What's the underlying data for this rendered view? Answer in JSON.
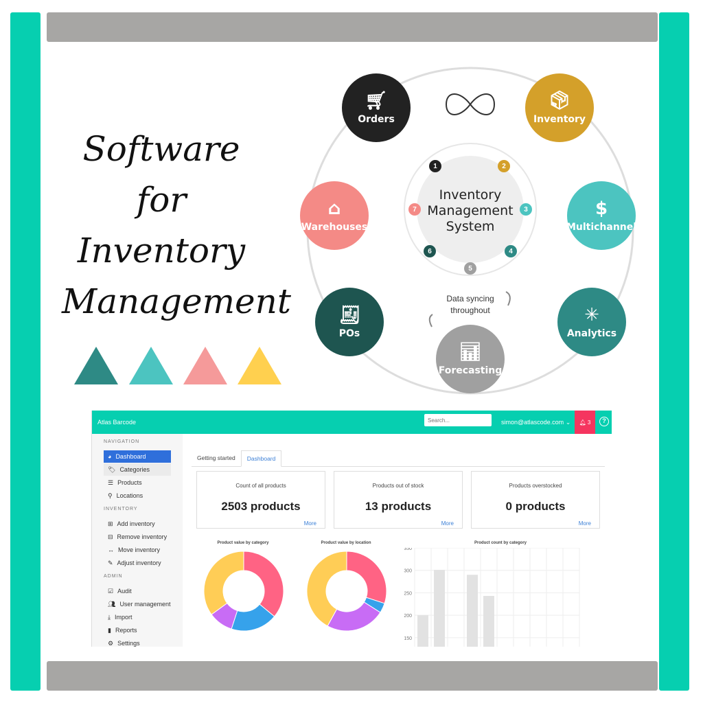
{
  "headline": {
    "line1": "Software",
    "line2": "for",
    "line3": "Inventory",
    "line4": "Management"
  },
  "triangle_colors": [
    "#2e8a85",
    "#4cc4c0",
    "#f59a9a",
    "#ffd04f"
  ],
  "diagram": {
    "center_label": [
      "Inventory",
      "Management",
      "System"
    ],
    "sync_label": [
      "Data syncing",
      "throughout"
    ],
    "nodes": [
      {
        "label": "Orders",
        "color": "#222222",
        "icon": "cart-icon"
      },
      {
        "label": "Inventory",
        "color": "#d4a02a",
        "icon": "box-icon"
      },
      {
        "label": "Warehouses",
        "color": "#f48a86",
        "icon": "warehouse-icon"
      },
      {
        "label": "Multichannel",
        "color": "#4cc4c0",
        "icon": "money-bag-icon"
      },
      {
        "label": "POs",
        "color": "#1e5550",
        "icon": "receipt-icon"
      },
      {
        "label": "Analytics",
        "color": "#2e8a85",
        "icon": "network-icon"
      },
      {
        "label": "Forecasting",
        "color": "#a0a0a0",
        "icon": "bar-chart-icon"
      }
    ],
    "numbers": [
      {
        "n": "1",
        "color": "#222222"
      },
      {
        "n": "2",
        "color": "#d4a02a"
      },
      {
        "n": "3",
        "color": "#4cc4c0"
      },
      {
        "n": "4",
        "color": "#2e8a85"
      },
      {
        "n": "5",
        "color": "#a0a0a0"
      },
      {
        "n": "6",
        "color": "#1e5550"
      },
      {
        "n": "7",
        "color": "#f48a86"
      }
    ]
  },
  "dashboard": {
    "app_title": "Atlas Barcode",
    "search_placeholder": "Search...",
    "user": "simon@atlascode.com",
    "notifications": "3",
    "sidebar": {
      "navigation": "NAVIGATION",
      "inventory": "INVENTORY",
      "admin": "ADMIN",
      "nav_items": [
        "Dashboard",
        "Categories",
        "Products",
        "Locations"
      ],
      "inv_items": [
        "Add inventory",
        "Remove inventory",
        "Move inventory",
        "Adjust inventory"
      ],
      "admin_items": [
        "Audit",
        "User management",
        "Import",
        "Reports",
        "Settings"
      ]
    },
    "tabs": [
      "Getting started",
      "Dashboard"
    ],
    "cards": [
      {
        "label": "Count of all products",
        "value": "2503 products",
        "more": "More"
      },
      {
        "label": "Products out of stock",
        "value": "13 products",
        "more": "More"
      },
      {
        "label": "Products overstocked",
        "value": "0 products",
        "more": "More"
      }
    ]
  },
  "chart_data": [
    {
      "type": "pie",
      "title": "Product value by category",
      "values": [
        36,
        19,
        10,
        35
      ],
      "colors": [
        "#ff6384",
        "#36a2eb",
        "#c86cf5",
        "#ffcd56"
      ]
    },
    {
      "type": "pie",
      "title": "Product value by location",
      "values": [
        30,
        4,
        24,
        42
      ],
      "colors": [
        "#ff6384",
        "#36a2eb",
        "#c86cf5",
        "#ffcd56"
      ]
    },
    {
      "type": "bar",
      "title": "Product count by category",
      "values": [
        200,
        301,
        null,
        290,
        243,
        null,
        null,
        null,
        null,
        null
      ],
      "ylim": [
        130,
        350
      ],
      "yticks": [
        "350",
        "300",
        "250",
        "200",
        "150"
      ],
      "grid": true
    }
  ]
}
